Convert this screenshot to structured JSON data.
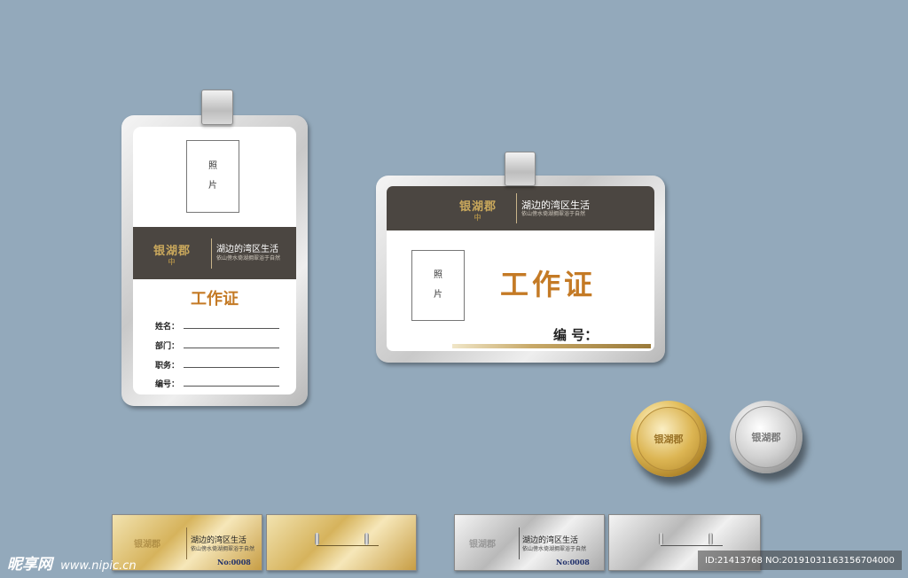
{
  "vertical_badge": {
    "photo_chars": [
      "照",
      "片"
    ],
    "logo": "银湖郡",
    "logo_sub": "中",
    "slogan": "湖边的湾区生活",
    "slogan_sub": "依山傍水倚湖拥翠浴于自然",
    "title": "工作证",
    "fields": [
      "姓名：",
      "部门：",
      "职务：",
      "编号："
    ]
  },
  "horizontal_badge": {
    "logo": "银湖郡",
    "logo_sub": "中",
    "slogan": "湖边的湾区生活",
    "slogan_sub": "依山傍水倚湖拥翠浴于自然",
    "photo_chars": [
      "照",
      "片"
    ],
    "title": "工作证",
    "number_label": "编 号："
  },
  "medals": {
    "gold_logo": "银湖郡",
    "silver_logo": "银湖郡"
  },
  "plates": {
    "logo": "银湖郡",
    "slogan": "湖边的湾区生活",
    "slogan_sub": "依山傍水倚湖拥翠浴于自然",
    "number": "No:0008"
  },
  "watermark": {
    "brand": "昵享网",
    "url": "www.nipic.cn",
    "id_text": "ID:21413768 NO:20191031163156704000"
  },
  "colors": {
    "background": "#93a9bb",
    "band": "#4b4641",
    "title": "#c47a25",
    "gold": "#c9a85c"
  }
}
